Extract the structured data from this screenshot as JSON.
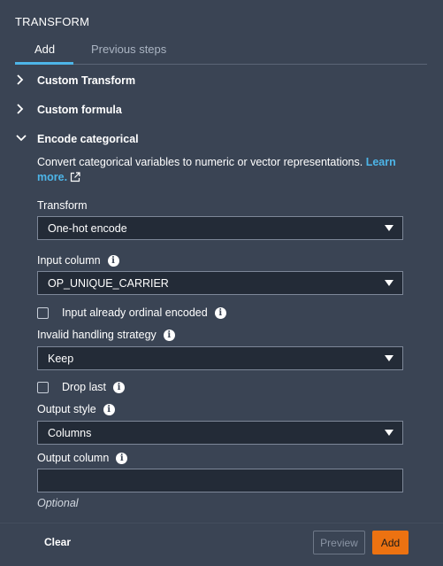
{
  "header": {
    "title": "TRANSFORM"
  },
  "tabs": [
    {
      "label": "Add"
    },
    {
      "label": "Previous steps"
    }
  ],
  "sections": [
    {
      "label": "Custom Transform",
      "expanded": false
    },
    {
      "label": "Custom formula",
      "expanded": false
    },
    {
      "label": "Encode categorical",
      "expanded": true
    }
  ],
  "encode": {
    "description": "Convert categorical variables to numeric or vector representations.",
    "learn_more_prefix": "Learn",
    "learn_more_suffix": "more.",
    "transform_label": "Transform",
    "transform_value": "One-hot encode",
    "input_column_label": "Input column",
    "input_column_value": "OP_UNIQUE_CARRIER",
    "ordinal_checkbox_label": "Input already ordinal encoded",
    "invalid_handling_label": "Invalid handling strategy",
    "invalid_handling_value": "Keep",
    "drop_last_label": "Drop last",
    "output_style_label": "Output style",
    "output_style_value": "Columns",
    "output_column_label": "Output column",
    "output_column_value": "",
    "optional_text": "Optional"
  },
  "footer": {
    "clear_label": "Clear",
    "preview_label": "Preview",
    "add_label": "Add"
  },
  "colors": {
    "background": "#3a4454",
    "accent_link": "#4db5e8",
    "primary_button": "#ec7211"
  }
}
